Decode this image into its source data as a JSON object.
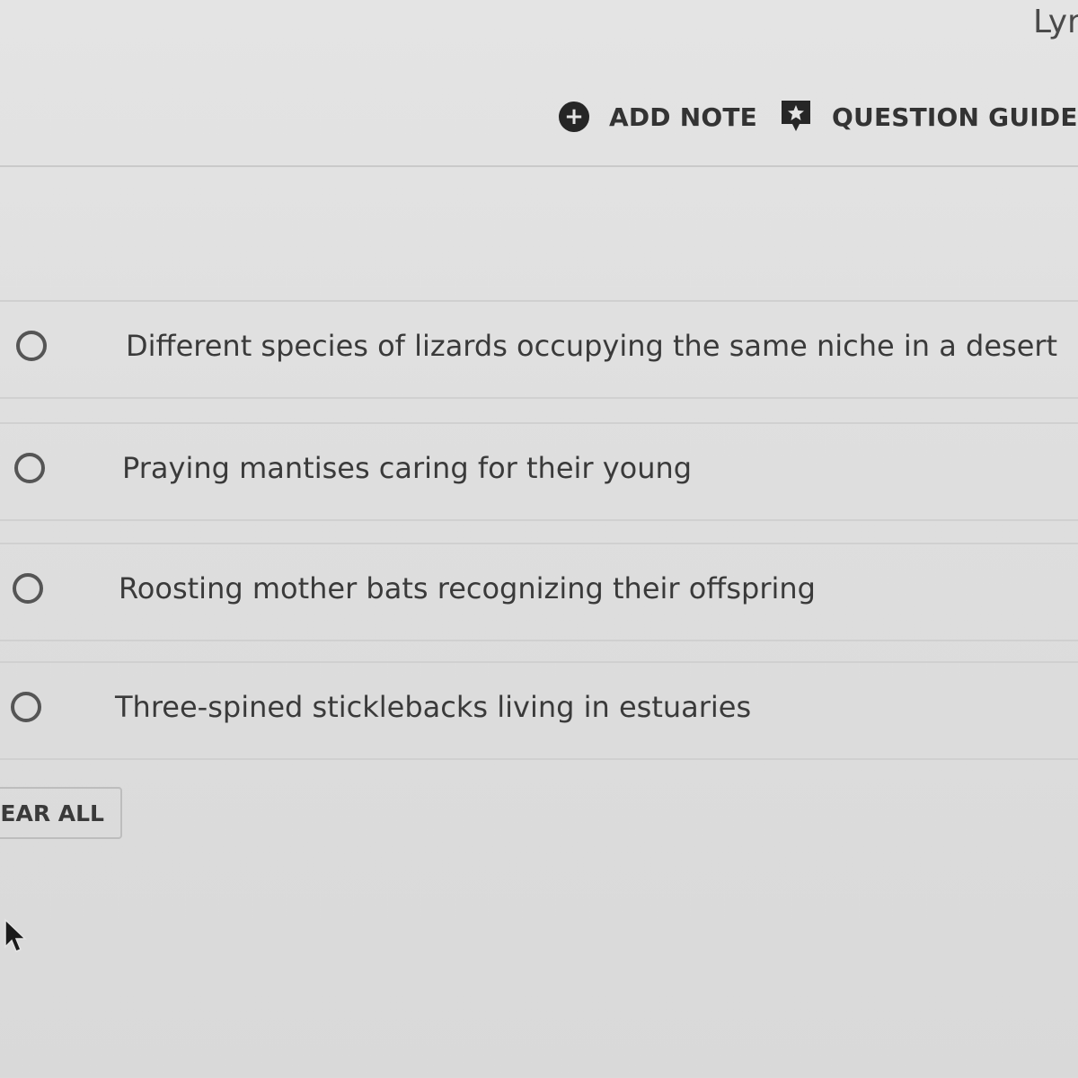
{
  "header": {
    "user_name": "Lyr",
    "add_note_label": "ADD NOTE",
    "question_guide_label": "QUESTION GUIDE"
  },
  "choices": [
    {
      "label": "Different species of lizards occupying the same niche in a desert",
      "selected": false
    },
    {
      "label": "Praying mantises caring for their young",
      "selected": false
    },
    {
      "label": "Roosting mother bats recognizing their offspring",
      "selected": false
    },
    {
      "label": "Three-spined sticklebacks living in estuaries",
      "selected": false
    }
  ],
  "clear_all_label": "LEAR ALL",
  "icons": {
    "add_note": "circle-plus-icon",
    "question_guide": "guide-bubble-icon",
    "cursor": "mouse-pointer-icon"
  }
}
